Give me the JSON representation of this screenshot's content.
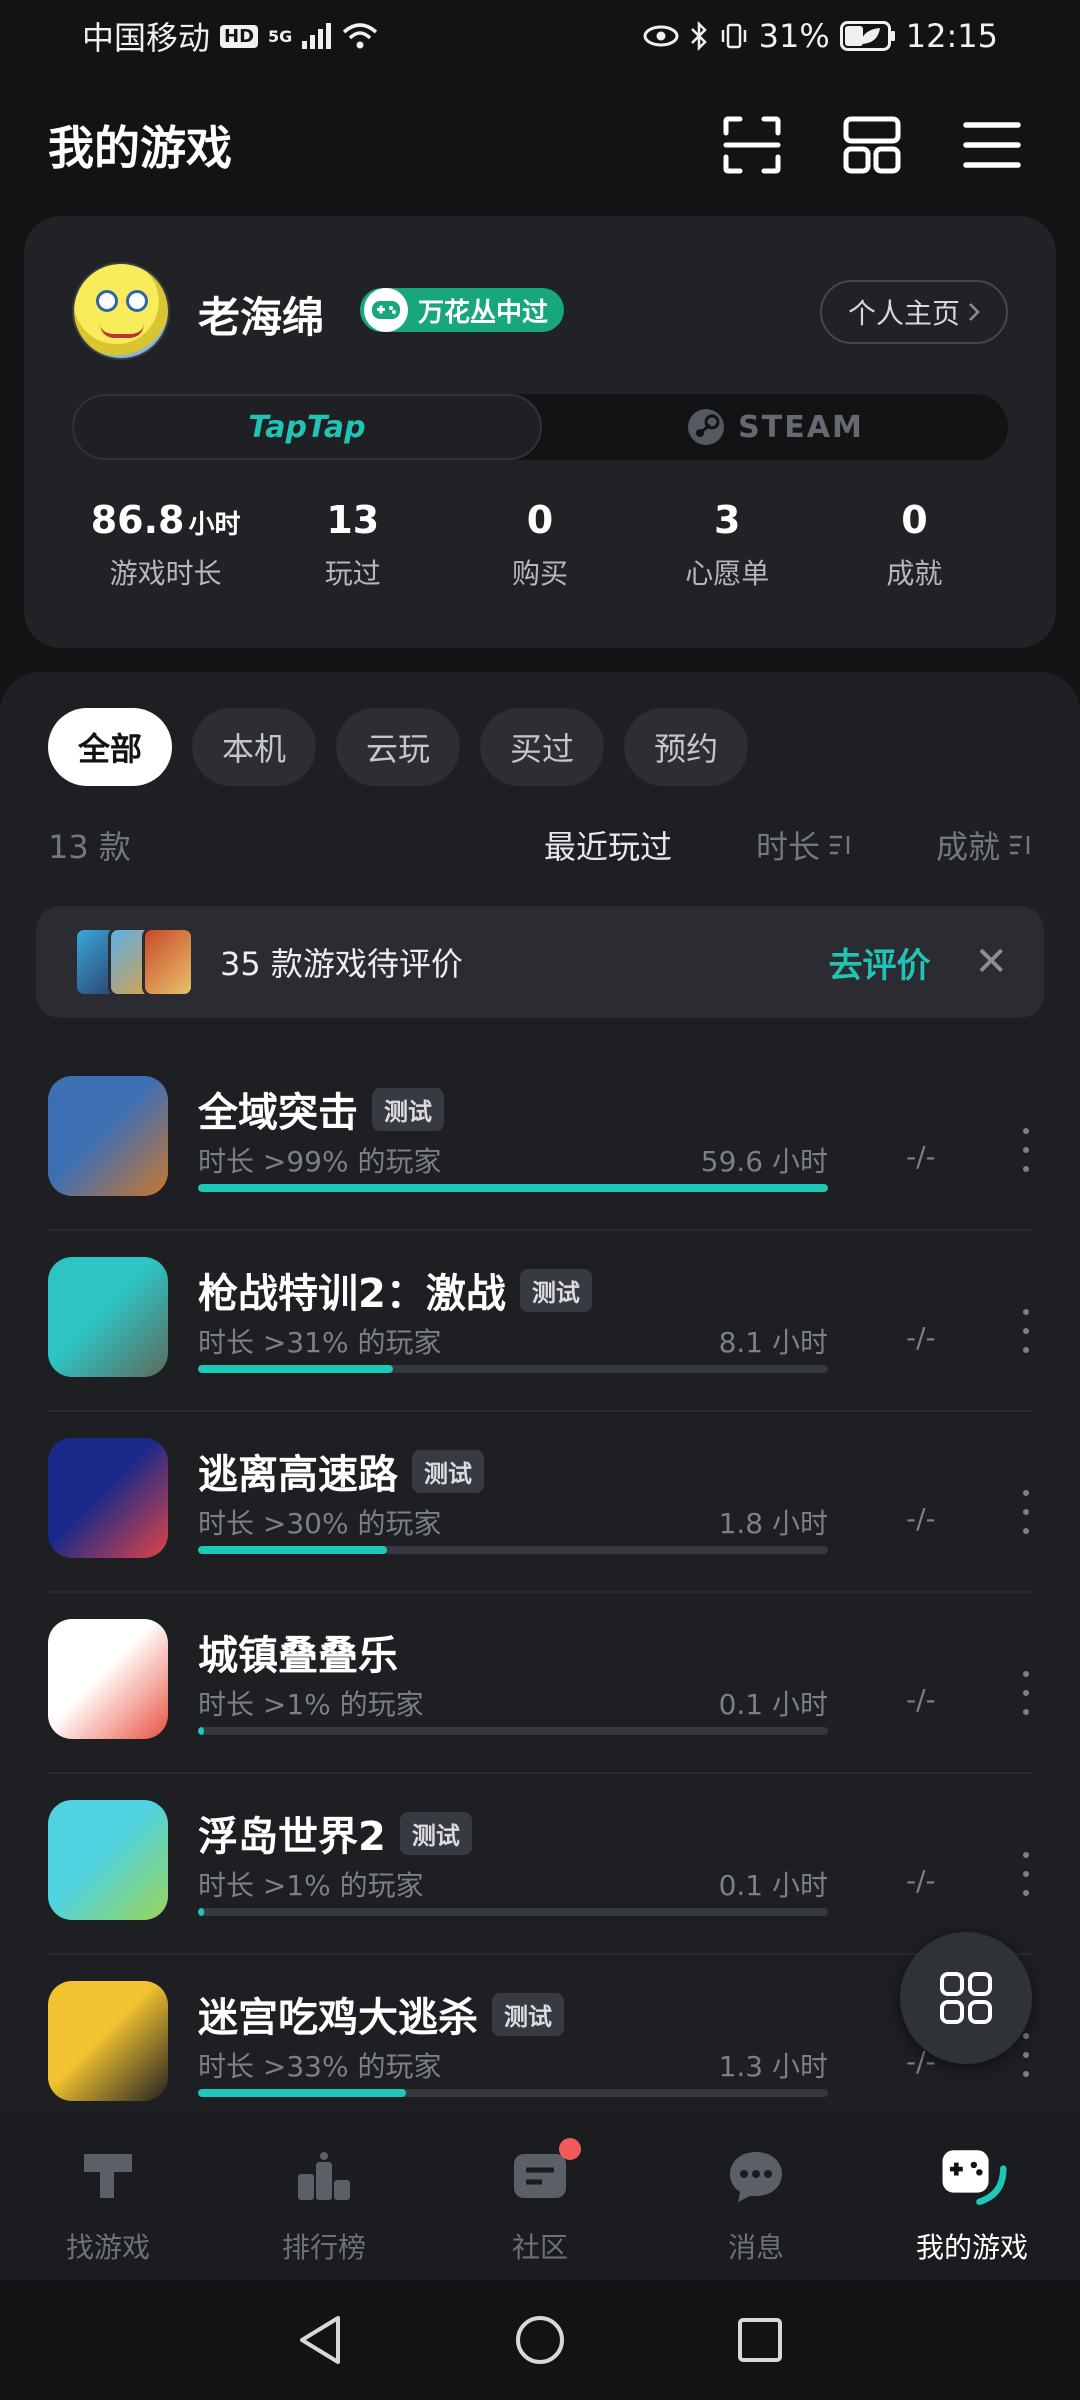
{
  "status_bar": {
    "carrier": "中国移动",
    "hd": "HD",
    "network": "5G",
    "battery": "31%",
    "time": "12:15"
  },
  "header": {
    "title": "我的游戏"
  },
  "profile": {
    "username": "老海绵",
    "badge": "万花丛中过",
    "homepage_button": "个人主页",
    "platforms": [
      "TapTap",
      "STEAM"
    ],
    "active_platform": "TapTap",
    "stats": [
      {
        "value": "86.8",
        "unit": "小时",
        "label": "游戏时长"
      },
      {
        "value": "13",
        "unit": "",
        "label": "玩过"
      },
      {
        "value": "0",
        "unit": "",
        "label": "购买"
      },
      {
        "value": "3",
        "unit": "",
        "label": "心愿单"
      },
      {
        "value": "0",
        "unit": "",
        "label": "成就"
      }
    ]
  },
  "filters": {
    "tabs": [
      "全部",
      "本机",
      "云玩",
      "买过",
      "预约"
    ],
    "active": "全部",
    "count": "13 款",
    "sort_options": [
      "最近玩过",
      "时长",
      "成就"
    ],
    "active_sort": "最近玩过"
  },
  "review_banner": {
    "text": "35 款游戏待评价",
    "action": "去评价"
  },
  "games": [
    {
      "name": "全域突击",
      "tag": "测试",
      "percentile": "时长 >99% 的玩家",
      "playtime": "59.6 小时",
      "progress": 1.0,
      "achievements": "-/-",
      "icon_colors": [
        "#3d6fb5",
        "#c9772d"
      ]
    },
    {
      "name": "枪战特训2：激战",
      "tag": "测试",
      "percentile": "时长 >31% 的玩家",
      "playtime": "8.1 小时",
      "progress": 0.31,
      "achievements": "-/-",
      "icon_colors": [
        "#2ec4c4",
        "#5c6a5a"
      ]
    },
    {
      "name": "逃离高速路",
      "tag": "测试",
      "percentile": "时长 >30% 的玩家",
      "playtime": "1.8 小时",
      "progress": 0.3,
      "achievements": "-/-",
      "icon_colors": [
        "#1a2a8a",
        "#e24444"
      ]
    },
    {
      "name": "城镇叠叠乐",
      "tag": "",
      "percentile": "时长 >1% 的玩家",
      "playtime": "0.1 小时",
      "progress": 0.01,
      "achievements": "-/-",
      "icon_colors": [
        "#ffffff",
        "#e8513e"
      ]
    },
    {
      "name": "浮岛世界2",
      "tag": "测试",
      "percentile": "时长 >1% 的玩家",
      "playtime": "0.1 小时",
      "progress": 0.01,
      "achievements": "-/-",
      "icon_colors": [
        "#4fd3e0",
        "#9ad35a"
      ]
    },
    {
      "name": "迷宫吃鸡大逃杀",
      "tag": "测试",
      "percentile": "时长 >33% 的玩家",
      "playtime": "1.3 小时",
      "progress": 0.33,
      "achievements": "-/-",
      "icon_colors": [
        "#f2c230",
        "#222222"
      ]
    }
  ],
  "bottom_nav": {
    "items": [
      "找游戏",
      "排行榜",
      "社区",
      "消息",
      "我的游戏"
    ],
    "active": "我的游戏"
  },
  "colors": {
    "accent": "#1fc7b6",
    "background": "#121315",
    "card": "#202226",
    "badge": "#18a77a",
    "notification": "#f15b5b"
  }
}
